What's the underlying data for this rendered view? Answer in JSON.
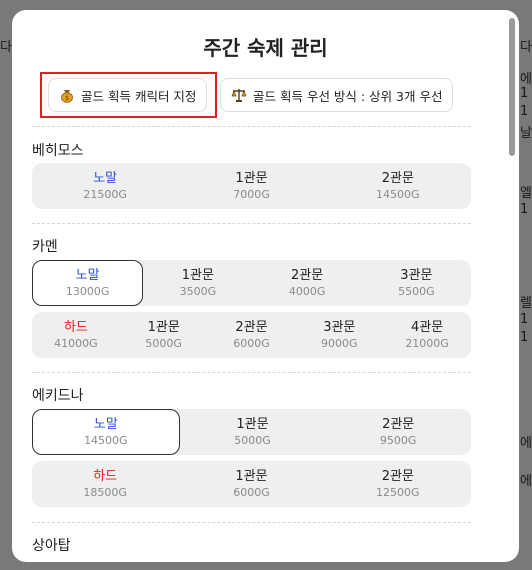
{
  "modal": {
    "title": "주간 숙제 관리",
    "chips": [
      {
        "label": "골드 획득 캐릭터 지정",
        "icon": "gold-bag-icon"
      },
      {
        "label": "골드 획득 우선 방식 : 상위 3개 우선",
        "icon": "scale-icon"
      }
    ]
  },
  "raids": [
    {
      "name": "베히모스",
      "rows": [
        [
          {
            "label": "노말",
            "gold": "21500G",
            "kind": "normal",
            "selected": false
          },
          {
            "label": "1관문",
            "gold": "7000G",
            "kind": "gate",
            "selected": false
          },
          {
            "label": "2관문",
            "gold": "14500G",
            "kind": "gate",
            "selected": false
          }
        ]
      ]
    },
    {
      "name": "카멘",
      "rows": [
        [
          {
            "label": "노말",
            "gold": "13000G",
            "kind": "normal",
            "selected": true
          },
          {
            "label": "1관문",
            "gold": "3500G",
            "kind": "gate",
            "selected": false
          },
          {
            "label": "2관문",
            "gold": "4000G",
            "kind": "gate",
            "selected": false
          },
          {
            "label": "3관문",
            "gold": "5500G",
            "kind": "gate",
            "selected": false
          }
        ],
        [
          {
            "label": "하드",
            "gold": "41000G",
            "kind": "hard",
            "selected": false
          },
          {
            "label": "1관문",
            "gold": "5000G",
            "kind": "gate",
            "selected": false
          },
          {
            "label": "2관문",
            "gold": "6000G",
            "kind": "gate",
            "selected": false
          },
          {
            "label": "3관문",
            "gold": "9000G",
            "kind": "gate",
            "selected": false
          },
          {
            "label": "4관문",
            "gold": "21000G",
            "kind": "gate",
            "selected": false
          }
        ]
      ]
    },
    {
      "name": "에키드나",
      "rows": [
        [
          {
            "label": "노말",
            "gold": "14500G",
            "kind": "normal",
            "selected": true
          },
          {
            "label": "1관문",
            "gold": "5000G",
            "kind": "gate",
            "selected": false
          },
          {
            "label": "2관문",
            "gold": "9500G",
            "kind": "gate",
            "selected": false
          }
        ],
        [
          {
            "label": "하드",
            "gold": "18500G",
            "kind": "hard",
            "selected": false
          },
          {
            "label": "1관문",
            "gold": "6000G",
            "kind": "gate",
            "selected": false
          },
          {
            "label": "2관문",
            "gold": "12500G",
            "kind": "gate",
            "selected": false
          }
        ]
      ]
    },
    {
      "name": "상아탑",
      "rows": []
    }
  ],
  "background": {
    "left_texts": [
      "다",
      "ㄹ",
      "1",
      "1",
      "닝",
      "엘",
      "1",
      "1",
      "렐",
      "1",
      "1",
      "에",
      "에"
    ]
  }
}
